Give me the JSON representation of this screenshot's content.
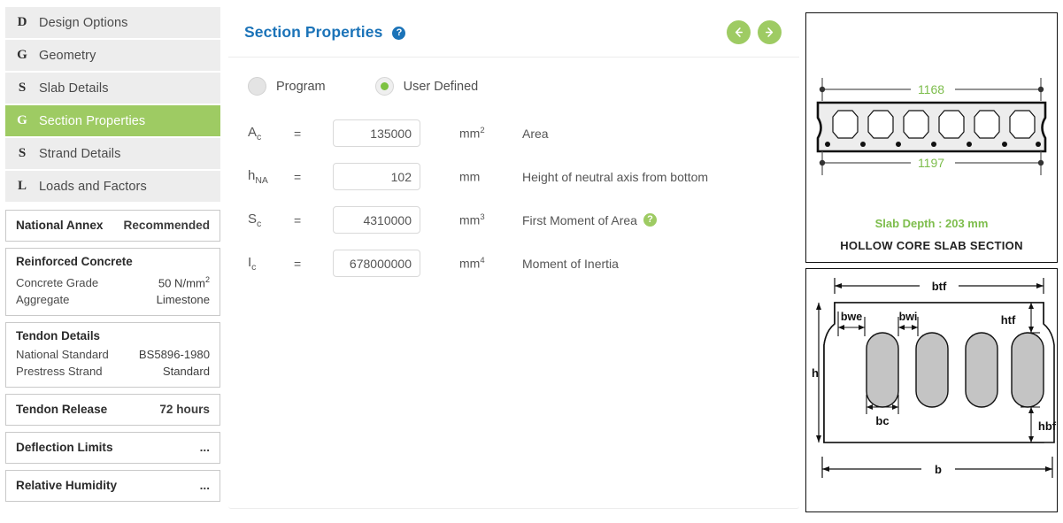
{
  "sidebar": {
    "nav_items": [
      {
        "icon": "D",
        "label": "Design Options",
        "active": false
      },
      {
        "icon": "G",
        "label": "Geometry",
        "active": false
      },
      {
        "icon": "S",
        "label": "Slab Details",
        "active": false
      },
      {
        "icon": "G",
        "label": "Section Properties",
        "active": true
      },
      {
        "icon": "S",
        "label": "Strand Details",
        "active": false
      },
      {
        "icon": "L",
        "label": "Loads and Factors",
        "active": false
      }
    ],
    "cards": [
      {
        "title": null,
        "rows": [
          {
            "key": "National Annex",
            "value": "Recommended"
          }
        ]
      },
      {
        "title": "Reinforced Concrete",
        "rows": [
          {
            "key": "Concrete Grade",
            "value": "50 N/mm",
            "value_sup": "2"
          },
          {
            "key": "Aggregate",
            "value": "Limestone"
          }
        ]
      },
      {
        "title": "Tendon Details",
        "rows": [
          {
            "key": "National Standard",
            "value": "BS5896-1980"
          },
          {
            "key": "Prestress Strand",
            "value": "Standard"
          }
        ]
      },
      {
        "title": null,
        "rows": [
          {
            "key": "Tendon Release",
            "value": "72 hours"
          }
        ]
      },
      {
        "title": null,
        "rows": [
          {
            "key": "Deflection Limits",
            "value": "..."
          }
        ]
      },
      {
        "title": null,
        "rows": [
          {
            "key": "Relative Humidity",
            "value": "..."
          }
        ]
      }
    ]
  },
  "main": {
    "title": "Section Properties",
    "help_glyph": "?",
    "prev_label": "Previous",
    "next_label": "Next",
    "mode_options": [
      {
        "label": "Program",
        "selected": false
      },
      {
        "label": "User Defined",
        "selected": true
      }
    ],
    "fields": [
      {
        "symbol": "A",
        "subscript": "c",
        "equals": "=",
        "value": "135000",
        "unit": "mm",
        "unit_sup": "2",
        "description": "Area",
        "has_help": false
      },
      {
        "symbol": "h",
        "subscript": "NA",
        "equals": "=",
        "value": "102",
        "unit": "mm",
        "unit_sup": "",
        "description": "Height of neutral axis from bottom",
        "has_help": false
      },
      {
        "symbol": "S",
        "subscript": "c",
        "equals": "=",
        "value": "4310000",
        "unit": "mm",
        "unit_sup": "3",
        "description": "First Moment of Area",
        "has_help": true
      },
      {
        "symbol": "I",
        "subscript": "c",
        "equals": "=",
        "value": "678000000",
        "unit": "mm",
        "unit_sup": "4",
        "description": "Moment of Inertia",
        "has_help": false
      }
    ]
  },
  "diagrams": {
    "section_view": {
      "top_dimension": "1168",
      "bottom_dimension": "1197",
      "slab_depth_text": "Slab Depth : 203 mm",
      "caption": "HOLLOW CORE SLAB SECTION",
      "void_count": 6,
      "strand_count": 7,
      "dimension_color": "#7dbd4c"
    },
    "parameter_view": {
      "labels": {
        "overall_top": "btf",
        "overall_bottom": "b",
        "height": "h",
        "web_exterior": "bwe",
        "web_interior": "bwi",
        "core_width": "bc",
        "top_flange": "htf",
        "bottom_flange": "hbf"
      },
      "void_count": 4
    }
  },
  "colors": {
    "accent_green": "#9ecb63",
    "title_blue": "#1b73b8",
    "radio_green": "#7dc242",
    "dimension_green": "#7dbd4c",
    "sidebar_gray": "#ededed"
  }
}
